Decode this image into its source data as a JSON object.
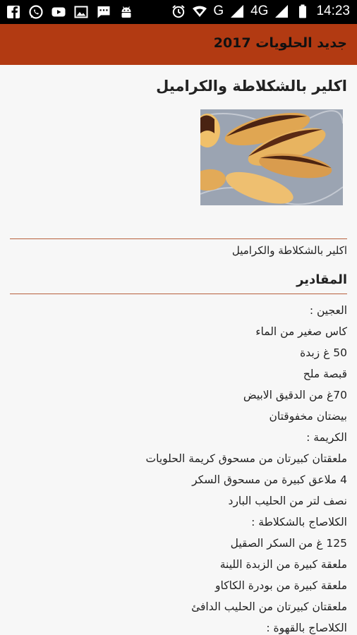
{
  "status_bar": {
    "network": "G",
    "network2": "4G",
    "time": "14:23",
    "left_icons": [
      "facebook-icon",
      "whatsapp-icon",
      "youtube-icon",
      "image-icon",
      "message-icon",
      "android-icon"
    ],
    "right_icons": [
      "alarm-icon",
      "wifi-icon",
      "signal-icon",
      "signal-4g-icon",
      "battery-icon"
    ]
  },
  "app_bar": {
    "title": "جديد الحلويات 2017",
    "color": "#b23a12"
  },
  "post": {
    "title": "اكلير بالشكلاطة والكراميل",
    "subtitle": "اكلير بالشكلاطة والكراميل",
    "section_heading": "المقادير",
    "lines": [
      "العجين :",
      "كاس صغير من الماء",
      "50 غ زبدة",
      "قبصة ملح",
      "70غ من الدقيق الابيض",
      "بيضتان مخفوقتان",
      "الكريمة :",
      "ملعقتان كبيرتان من مسحوق كريمة الحلويات",
      "4 ملاعق كبيرة من مسحوق السكر",
      "نصف لتر من الحليب البارد",
      "الكلاصاج بالشكلاطة :",
      "125 غ من السكر الصقيل",
      "ملعقة كبيرة من الزبدة اللينة",
      "ملعقة كبيرة من بودرة الكاكاو",
      "ملعقتان كبيرتان من الحليب الدافئ",
      "الكلاصاج بالقهوة :"
    ]
  }
}
